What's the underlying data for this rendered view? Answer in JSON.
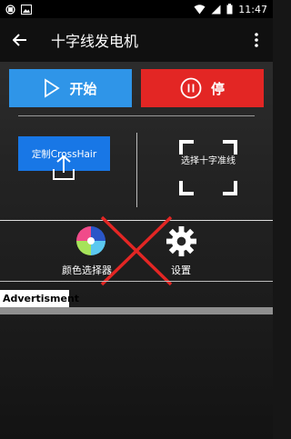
{
  "status_bar": {
    "time": "11:47"
  },
  "app_bar": {
    "title": "十字线发电机"
  },
  "actions": {
    "start_label": "开始",
    "stop_label": "停"
  },
  "tools": {
    "custom_crosshair_label": "定制CrossHair",
    "select_crosshair_label": "选择十字准线",
    "color_picker_label": "颜色选择器",
    "settings_label": "设置"
  },
  "ad": {
    "label": "Advertisment"
  },
  "colors": {
    "start": "#2f95e8",
    "stop": "#e32624",
    "crosshair_button": "#1877e6",
    "cross_mark": "#e32624"
  }
}
